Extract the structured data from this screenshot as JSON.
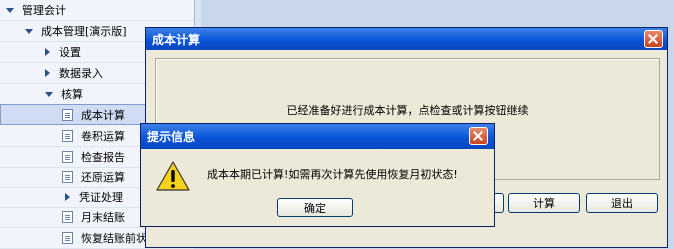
{
  "tree": {
    "items": [
      {
        "label": "管理会计",
        "level": 0,
        "icon": "triangle-down-icon"
      },
      {
        "label": "成本管理[演示版]",
        "level": 1,
        "icon": "triangle-down-icon"
      },
      {
        "label": "设置",
        "level": 2,
        "icon": "triangle-right-icon"
      },
      {
        "label": "数据录入",
        "level": 2,
        "icon": "triangle-right-icon"
      },
      {
        "label": "核算",
        "level": 2,
        "icon": "triangle-down-icon"
      },
      {
        "label": "成本计算",
        "level": 3,
        "icon": "document-icon",
        "selected": true
      },
      {
        "label": "卷积运算",
        "level": 3,
        "icon": "document-icon"
      },
      {
        "label": "检查报告",
        "level": 3,
        "icon": "document-icon"
      },
      {
        "label": "还原运算",
        "level": 3,
        "icon": "document-icon"
      },
      {
        "label": "凭证处理",
        "level": 3,
        "icon": "triangle-right-icon"
      },
      {
        "label": "月末结账",
        "level": 3,
        "icon": "document-icon"
      },
      {
        "label": "恢复结账前状态",
        "level": 3,
        "icon": "document-icon"
      }
    ]
  },
  "main_dialog": {
    "title": "成本计算",
    "message": "已经准备好进行成本计算，点检查或计算按钮继续",
    "buttons": {
      "calc": "计算",
      "exit": "退出"
    }
  },
  "prompt_dialog": {
    "title": "提示信息",
    "message": "成本本期已计算!如需再次计算先使用恢复月初状态!",
    "ok": "确定",
    "icon": "warning-icon"
  },
  "colors": {
    "titlebar": "#0a55d8",
    "dialog_bg": "#ece9d8",
    "tree_bg": "#f1f5fb",
    "desktop_bg": "#c9d7ec"
  }
}
